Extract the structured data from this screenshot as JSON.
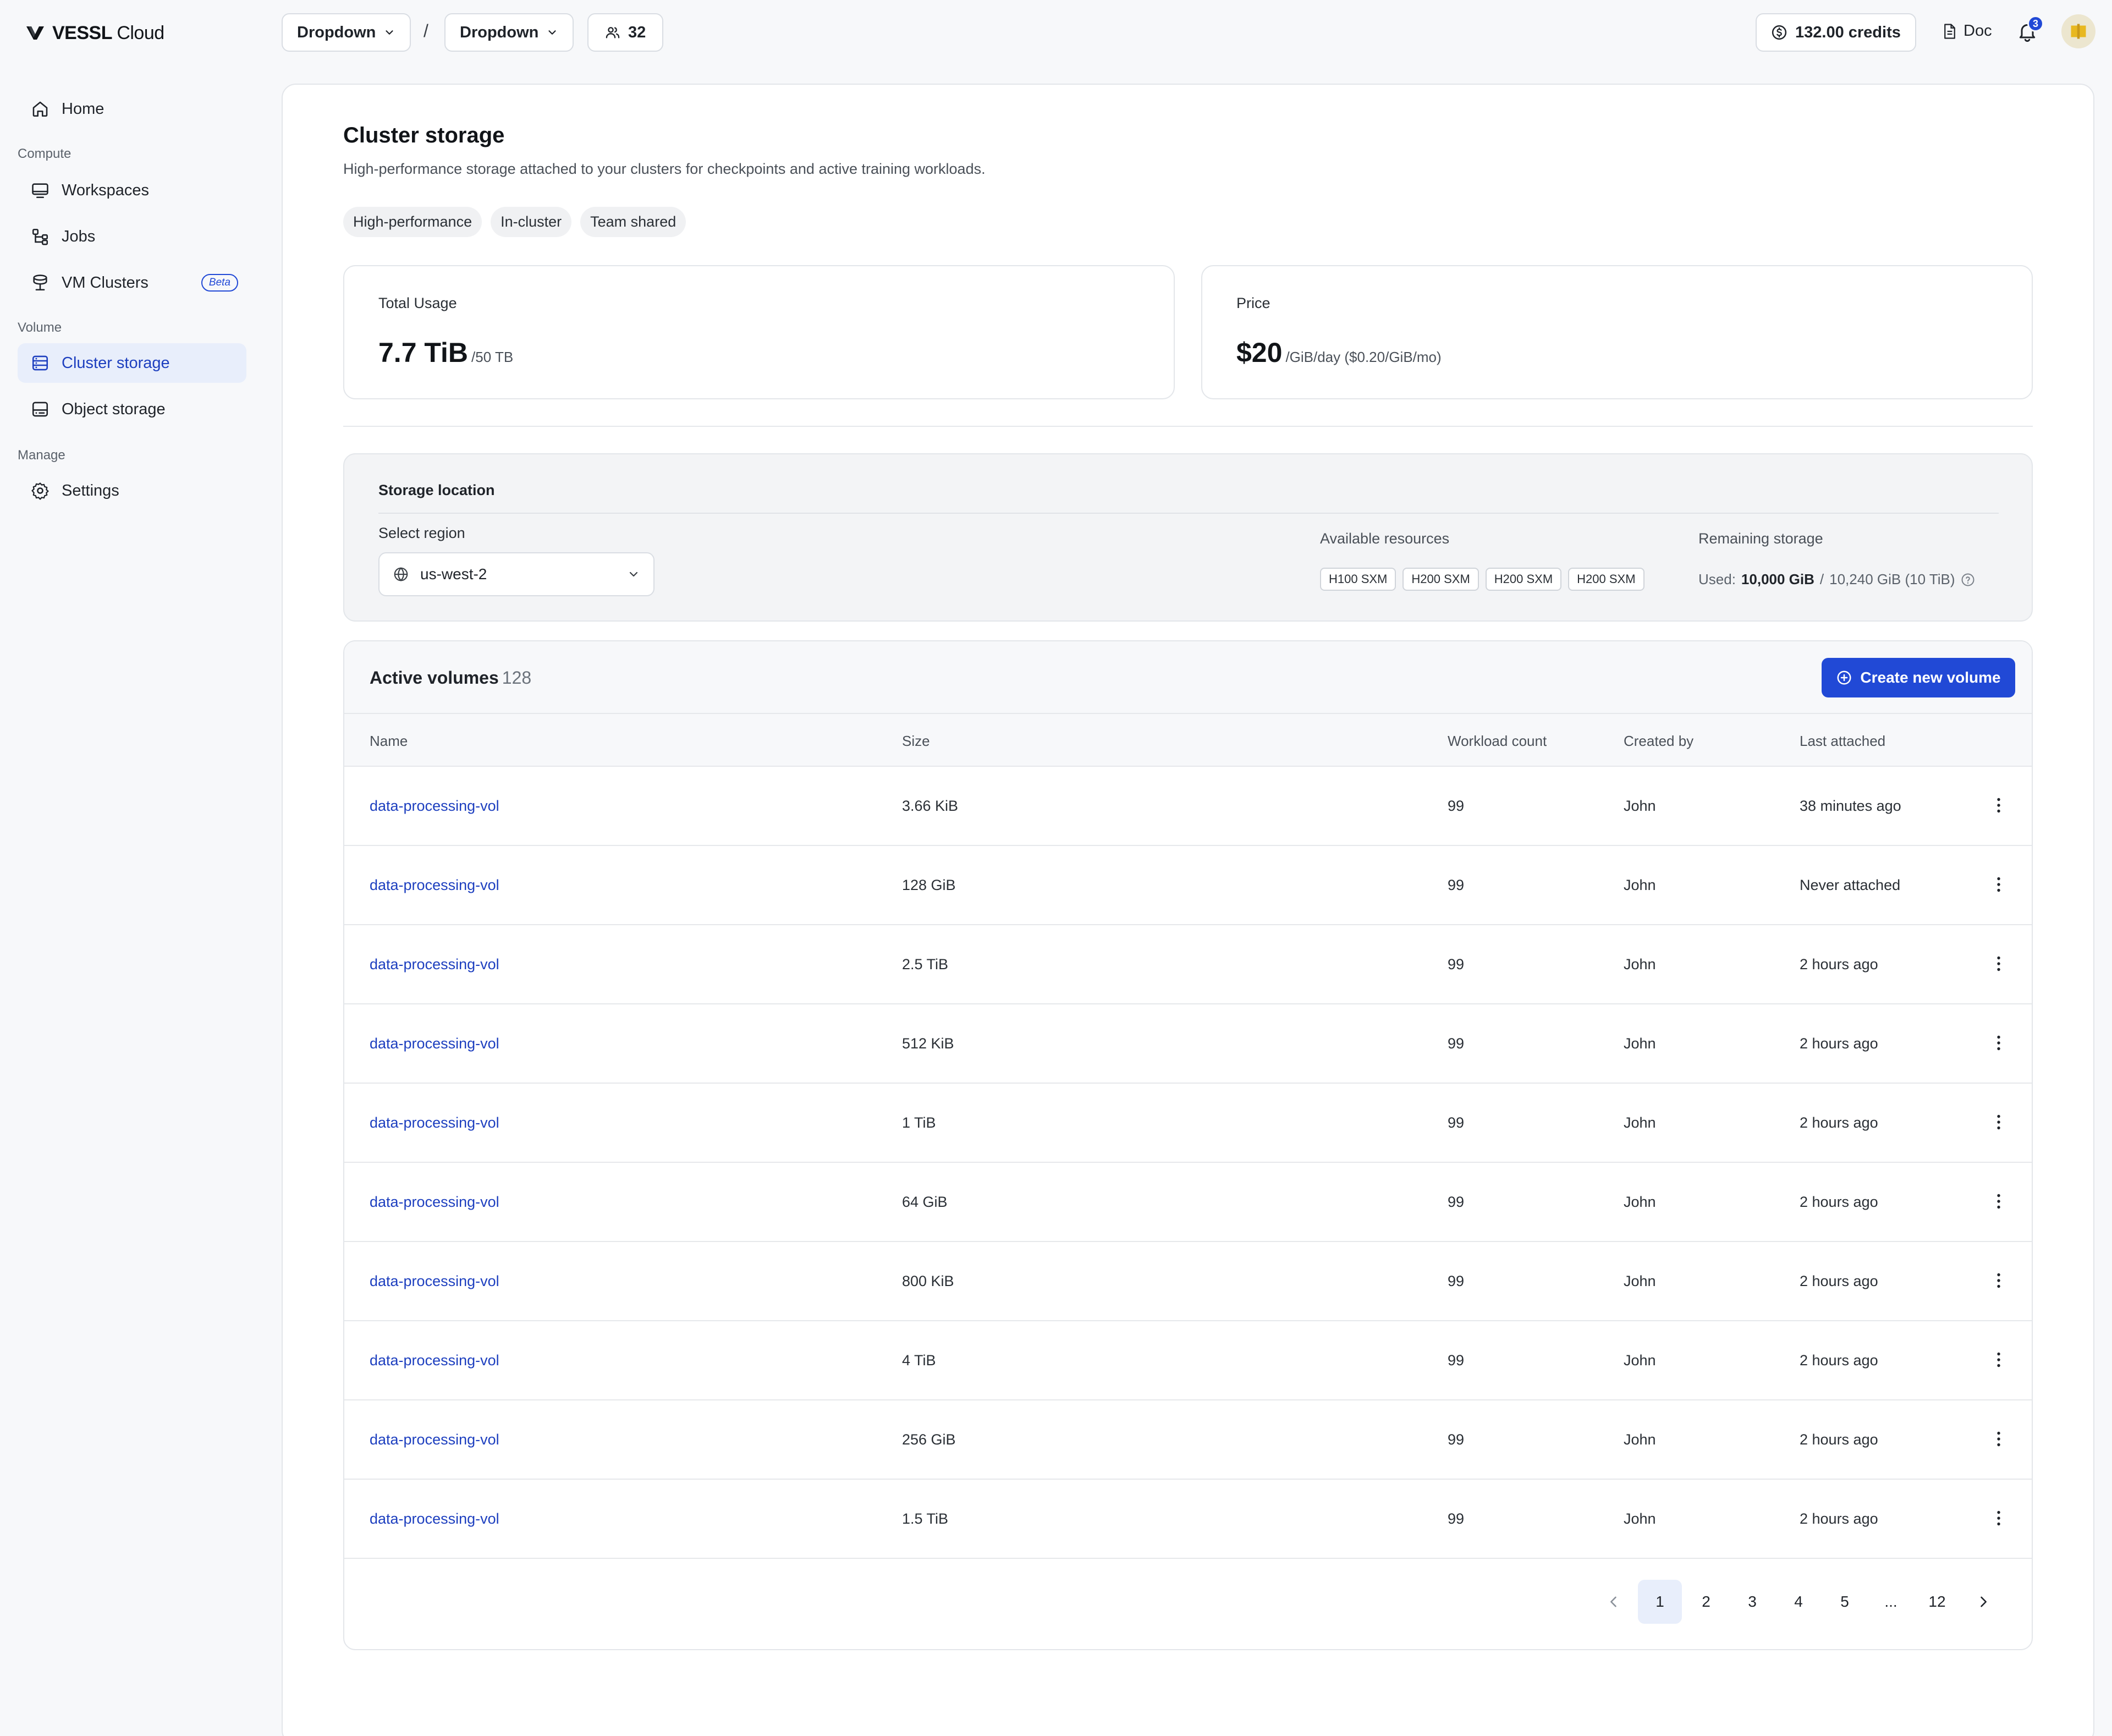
{
  "brand": {
    "name_bold": "VESSL",
    "name_light": "Cloud"
  },
  "topbar": {
    "dropdown1": "Dropdown",
    "separator": "/",
    "dropdown2": "Dropdown",
    "members_count": "32",
    "credits": "132.00 credits",
    "doc": "Doc",
    "notifications_count": "3"
  },
  "sidebar": {
    "home": "Home",
    "compute_label": "Compute",
    "workspaces": "Workspaces",
    "jobs": "Jobs",
    "vm_clusters": "VM Clusters",
    "beta": "Beta",
    "volume_label": "Volume",
    "cluster_storage": "Cluster storage",
    "object_storage": "Object storage",
    "manage_label": "Manage",
    "settings": "Settings"
  },
  "page": {
    "title": "Cluster storage",
    "subtitle": "High-performance storage attached to your clusters for checkpoints and active training workloads.",
    "tags": [
      "High-performance",
      "In-cluster",
      "Team shared"
    ]
  },
  "usage": {
    "label": "Total Usage",
    "value": "7.7 TiB",
    "suffix": "/50 TB"
  },
  "price": {
    "label": "Price",
    "value": "$20",
    "suffix": "/GiB/day ($0.20/GiB/mo)"
  },
  "location": {
    "title": "Storage location",
    "select_label": "Select region",
    "region": "us-west-2",
    "resources_label": "Available resources",
    "resources": [
      "H100 SXM",
      "H200 SXM",
      "H200 SXM",
      "H200 SXM"
    ],
    "remaining_label": "Remaining storage",
    "used_prefix": "Used:",
    "used_value": "10,000 GiB",
    "used_sep": "/",
    "used_total": "10,240 GiB (10 TiB)"
  },
  "volumes": {
    "title": "Active volumes",
    "count": "128",
    "create_label": "Create new volume",
    "columns": [
      "Name",
      "Size",
      "Workload count",
      "Created by",
      "Last attached"
    ],
    "rows": [
      {
        "name": "data-processing-vol",
        "size": "3.66 KiB",
        "workloads": "99",
        "created_by": "John",
        "last_attached": "38 minutes ago"
      },
      {
        "name": "data-processing-vol",
        "size": "128 GiB",
        "workloads": "99",
        "created_by": "John",
        "last_attached": "Never attached"
      },
      {
        "name": "data-processing-vol",
        "size": "2.5 TiB",
        "workloads": "99",
        "created_by": "John",
        "last_attached": "2 hours ago"
      },
      {
        "name": "data-processing-vol",
        "size": "512 KiB",
        "workloads": "99",
        "created_by": "John",
        "last_attached": "2 hours ago"
      },
      {
        "name": "data-processing-vol",
        "size": "1 TiB",
        "workloads": "99",
        "created_by": "John",
        "last_attached": "2 hours ago"
      },
      {
        "name": "data-processing-vol",
        "size": "64 GiB",
        "workloads": "99",
        "created_by": "John",
        "last_attached": "2 hours ago"
      },
      {
        "name": "data-processing-vol",
        "size": "800 KiB",
        "workloads": "99",
        "created_by": "John",
        "last_attached": "2 hours ago"
      },
      {
        "name": "data-processing-vol",
        "size": "4 TiB",
        "workloads": "99",
        "created_by": "John",
        "last_attached": "2 hours ago"
      },
      {
        "name": "data-processing-vol",
        "size": "256 GiB",
        "workloads": "99",
        "created_by": "John",
        "last_attached": "2 hours ago"
      },
      {
        "name": "data-processing-vol",
        "size": "1.5 TiB",
        "workloads": "99",
        "created_by": "John",
        "last_attached": "2 hours ago"
      }
    ]
  },
  "pagination": {
    "pages": [
      "1",
      "2",
      "3",
      "4",
      "5",
      "...",
      "12"
    ],
    "current": "1"
  },
  "colors": {
    "accent": "#2149d6",
    "link": "#1d3fbf",
    "active_bg": "#e8eefb"
  }
}
